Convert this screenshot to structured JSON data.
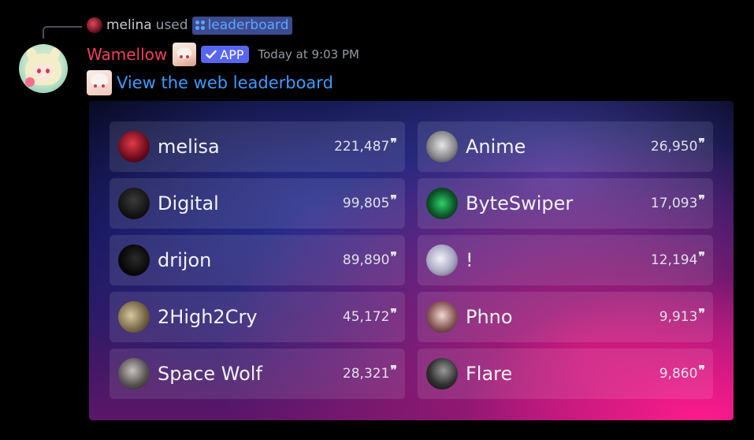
{
  "reply": {
    "user": "melina",
    "verb": "used",
    "command": "leaderboard"
  },
  "message": {
    "author": "Wamellow",
    "app_tag": "APP",
    "timestamp": "Today at 9:03 PM",
    "link_text": "View the web leaderboard"
  },
  "leaderboard": {
    "left": [
      {
        "name": "melisa",
        "score": "221,487"
      },
      {
        "name": "Digital",
        "score": "99,805"
      },
      {
        "name": "drijon",
        "score": "89,890"
      },
      {
        "name": "2High2Cry",
        "score": "45,172"
      },
      {
        "name": "Space Wolf",
        "score": "28,321"
      }
    ],
    "right": [
      {
        "name": "Anime",
        "score": "26,950"
      },
      {
        "name": "ByteSwiper",
        "score": "17,093"
      },
      {
        "name": "!",
        "score": "12,194"
      },
      {
        "name": "Phno",
        "score": "9,913"
      },
      {
        "name": "Flare",
        "score": "9,860"
      }
    ],
    "score_icon": "quote-icon"
  },
  "colors": {
    "username": "#f23f5e",
    "link": "#3c9bff",
    "app_tag": "#5865f2",
    "background": "#000000"
  }
}
